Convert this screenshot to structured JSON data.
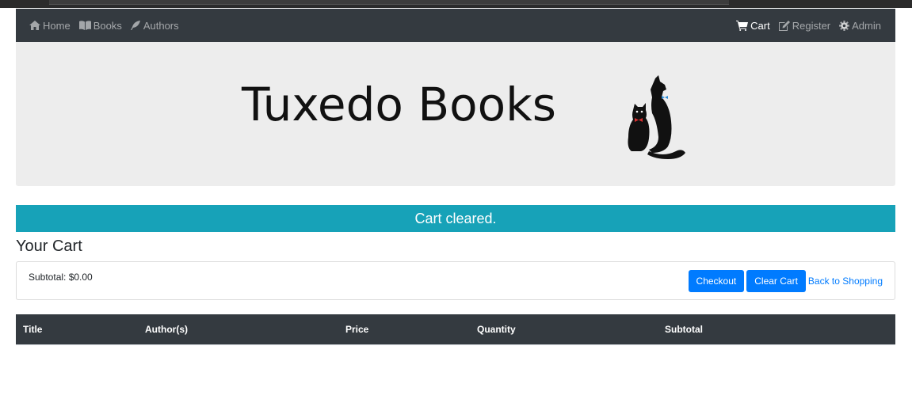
{
  "nav": {
    "left": [
      {
        "label": "Home",
        "icon": "home-icon"
      },
      {
        "label": "Books",
        "icon": "book-icon"
      },
      {
        "label": "Authors",
        "icon": "feather-icon"
      }
    ],
    "right": [
      {
        "label": "Cart",
        "icon": "cart-icon",
        "active": true
      },
      {
        "label": "Register",
        "icon": "edit-icon"
      },
      {
        "label": "Admin",
        "icon": "gear-icon"
      }
    ]
  },
  "banner": {
    "logo_text": "Tuxedo Books"
  },
  "alert": {
    "message": "Cart cleared."
  },
  "cart": {
    "heading": "Your Cart",
    "subtotal": "Subtotal: $0.00",
    "checkout_label": "Checkout",
    "clear_label": "Clear Cart",
    "back_label": "Back to Shopping"
  },
  "table": {
    "columns": [
      "Title",
      "Author(s)",
      "Price",
      "Quantity",
      "Subtotal"
    ]
  },
  "colors": {
    "navbar": "#343a40",
    "alert": "#17a2b8",
    "primary": "#007bff",
    "banner": "#ededed"
  }
}
